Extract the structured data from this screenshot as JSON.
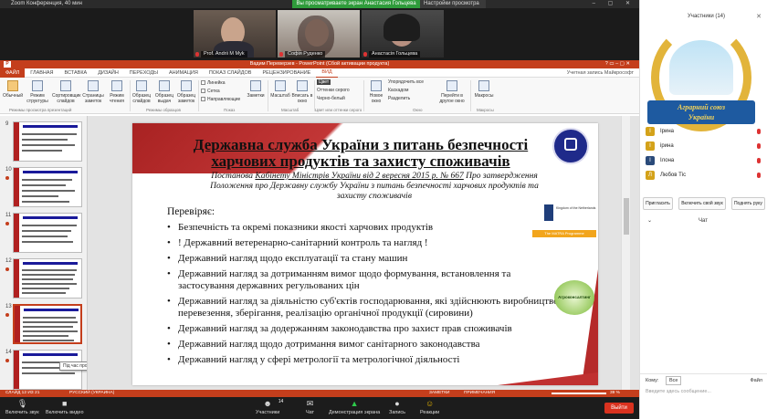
{
  "zoom": {
    "window_title": "Zoom Конференция, 40 мин",
    "share_banner": "Вы просматриваете экран Анастасия Гольцева",
    "view_settings": "Настройки просмотра",
    "tiles": [
      {
        "name": "Prof. Andrii M Myk"
      },
      {
        "name": "Софія Руденко"
      },
      {
        "name": "Анастасія Гольцева"
      }
    ],
    "bottom_bar": {
      "unmute": "Включить звук",
      "video": "Включить видео",
      "participants": "Участники",
      "participants_count": "14",
      "chat": "Чат",
      "share_screen": "Демонстрация экрана",
      "record": "Запись",
      "reactions": "Реакции",
      "end": "Выйти"
    }
  },
  "powerpoint": {
    "title": "Вадим Переверзев - PowerPoint (Сбой активации продукта)",
    "account": "Учетная запись Майкрософт",
    "logo_letter": "P",
    "tabs": [
      "ФАЙЛ",
      "ГЛАВНАЯ",
      "ВСТАВКА",
      "ДИЗАЙН",
      "ПЕРЕХОДЫ",
      "АНИМАЦИЯ",
      "ПОКАЗ СЛАЙДОВ",
      "РЕЦЕНЗИРОВАНИЕ",
      "ВИД"
    ],
    "ribbon": {
      "buttons": [
        "Обычный",
        "Режим структуры",
        "Сортировщик слайдов",
        "Страницы заметок",
        "Режим чтения",
        "Образец слайдов",
        "Образец выдач",
        "Образец заметок",
        "Заметки",
        "Масштаб",
        "Вписать в окно",
        "Новое окно",
        "Перейти в другое окно",
        "Макросы"
      ],
      "checkboxes": [
        "Линейка",
        "Сетка",
        "Направляющие"
      ],
      "color_opts": [
        "Цвет",
        "Оттенки серого",
        "Черно-белый"
      ],
      "window_opts": [
        "Упорядочить все",
        "Каскадом",
        "Разделить"
      ],
      "groups": [
        "Режимы просмотра презентаций",
        "Режимы образцов",
        "Показ",
        "Масштаб",
        "Цвет или оттенки серого",
        "Окно",
        "Макросы"
      ]
    },
    "thumbs": [
      {
        "num": "9"
      },
      {
        "num": "10"
      },
      {
        "num": "11"
      },
      {
        "num": "12"
      },
      {
        "num": "13"
      },
      {
        "num": "14"
      }
    ],
    "tooltip": "Під час проведення перевірки",
    "slide": {
      "title": "Державна служба України з питань безпечності харчових продуктів та захисту споживачів",
      "subtitle_prefix": "Постанова ",
      "subtitle_link": "Кабінету Міністрів України від 2 вересня 2015 р. № 667",
      "subtitle_rest": " Про затвердження Положення про Державну службу України з питань безпечності харчових продуктів та захисту споживачів",
      "heading": "Перевіряє:",
      "bullets": [
        "Безпечність та окремі показники якості харчових продуктів",
        "! Державний ветеренарно-санітарний контроль та нагляд !",
        "Державний нагляд щодо експлуатації та стану машин",
        "Державний нагляд за дотриманням вимог щодо формування, встановлення та застосування державних регульованих цін",
        "Державний нагляд за діяльністю суб'єктів господарювання, які здійснюють виробництво, перевезення, зберігання, реалізацію органічної продукції (сировини)",
        "Державний нагляд за додержанням законодавства про захист прав споживачів",
        "Державний нагляд щодо дотримання вимог санітарного законодавства",
        "Державний нагляд у сфері метрології та метрологічної діяльності"
      ],
      "nl_text": "Kingdom of the Netherlands",
      "matra_text": "The MATRA Programme",
      "agro_text": "Агроконсалтинг"
    },
    "status": {
      "slide_of": "СЛАЙД 12 ИЗ 21",
      "lang": "РУССКИЙ (УКРАИНА)",
      "notes": "ЗАМЕТКИ",
      "comments": "ПРИМЕЧАНИЯ",
      "zoom": "39 %"
    }
  },
  "right_panel": {
    "title": "Участники",
    "count": "(14)",
    "logo_line1": "Аграрний союз",
    "logo_line2": "України",
    "participants": [
      {
        "initial": "І",
        "name": "Ірина",
        "color": "#d4a21a"
      },
      {
        "initial": "І",
        "name": "ірина",
        "color": "#d4a21a"
      },
      {
        "initial": "І",
        "name": "Ілона",
        "color": "#2a4a7a"
      },
      {
        "initial": "Л",
        "name": "Любов Тіс",
        "color": "#d4a21a"
      }
    ],
    "buttons": [
      "Пригласить",
      "Включить свой звук",
      "Поднять руку"
    ],
    "chat_title": "Чат",
    "to_label": "Кому:",
    "to_value": "Все",
    "file_label": "Файл",
    "input_placeholder": "Введите здесь сообщение..."
  }
}
